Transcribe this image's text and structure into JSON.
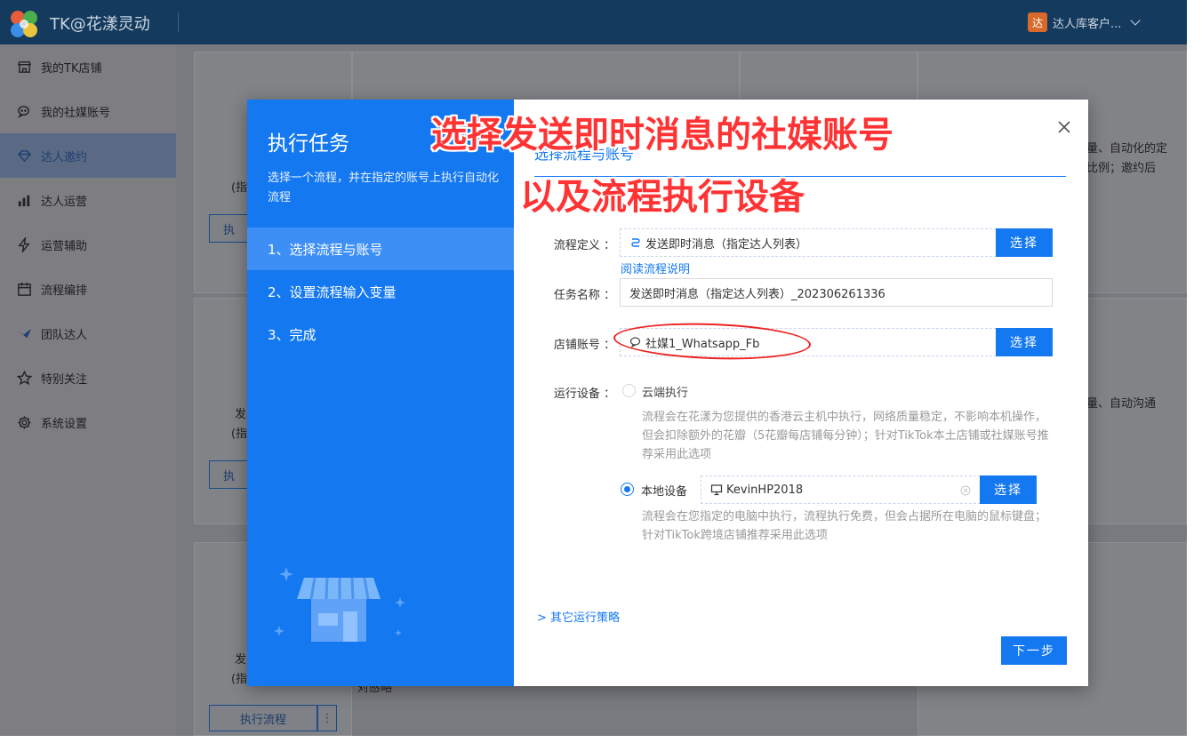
{
  "app": {
    "title": "TK@花漾灵动",
    "user": "达人库客户...",
    "user_avatar": "达"
  },
  "sidebar": {
    "items": [
      {
        "label": "我的TK店铺",
        "icon": "store-icon"
      },
      {
        "label": "我的社媒账号",
        "icon": "chat-icon"
      },
      {
        "label": "达人邀约",
        "icon": "diamond-icon",
        "active": true
      },
      {
        "label": "达人运营",
        "icon": "bar-chart-icon"
      },
      {
        "label": "运营辅助",
        "icon": "lightning-icon"
      },
      {
        "label": "流程编排",
        "icon": "calendar-icon"
      },
      {
        "label": "团队达人",
        "icon": "bird-icon"
      },
      {
        "label": "特别关注",
        "icon": "star-icon"
      },
      {
        "label": "系统设置",
        "icon": "gear-icon"
      }
    ]
  },
  "background": {
    "snippet1": "(指",
    "snippet2": "执",
    "snippet3": "发",
    "snippet4": "(指",
    "snippet5": "执",
    "snippet6": "发",
    "snippet7": "(指",
    "run_flow_button": "执行流程",
    "snippet8": "对感略",
    "right1": "量、自动化的定",
    "right2": "比例；邀约后",
    "right3": "量、自动沟通"
  },
  "modal": {
    "title": "执行任务",
    "description": "选择一个流程，并在指定的账号上执行自动化流程",
    "steps": [
      "1、选择流程与账号",
      "2、设置流程输入变量",
      "3、完成"
    ],
    "section_title": "选择流程与账号",
    "form": {
      "flow_label": "流程定义 ：",
      "flow_value": "发送即时消息（指定达人列表）",
      "flow_select": "选择",
      "read_flow_link": "阅读流程说明",
      "task_label": "任务名称 ：",
      "task_value": "发送即时消息（指定达人列表）_202306261336",
      "account_label": "店铺账号 ：",
      "account_value": "社媒1_Whatsapp_Fb",
      "account_select": "选择",
      "device_label": "运行设备 ：",
      "cloud_option": "云端执行",
      "cloud_hint": "流程会在花漾为您提供的香港云主机中执行，网络质量稳定，不影响本机操作，但会扣除额外的花瓣（5花瓣每店铺每分钟）；针对TikTok本土店铺或社媒账号推荐采用此选项",
      "local_option": "本地设备",
      "local_device": "KevinHP2018",
      "local_select": "选择",
      "local_hint": "流程会在您指定的电脑中执行，流程执行免费，但会占据所在电脑的鼠标键盘；针对TikTok跨境店铺推荐采用此选项",
      "other_strategies": "其它运行策略",
      "next_button": "下一步"
    }
  },
  "annotation": {
    "line1": "选择发送即时消息的社媒账号",
    "line2": "以及流程执行设备"
  },
  "colors": {
    "primary": "#1478f0",
    "annotation": "#ff3333",
    "topbar": "#143a5e"
  }
}
